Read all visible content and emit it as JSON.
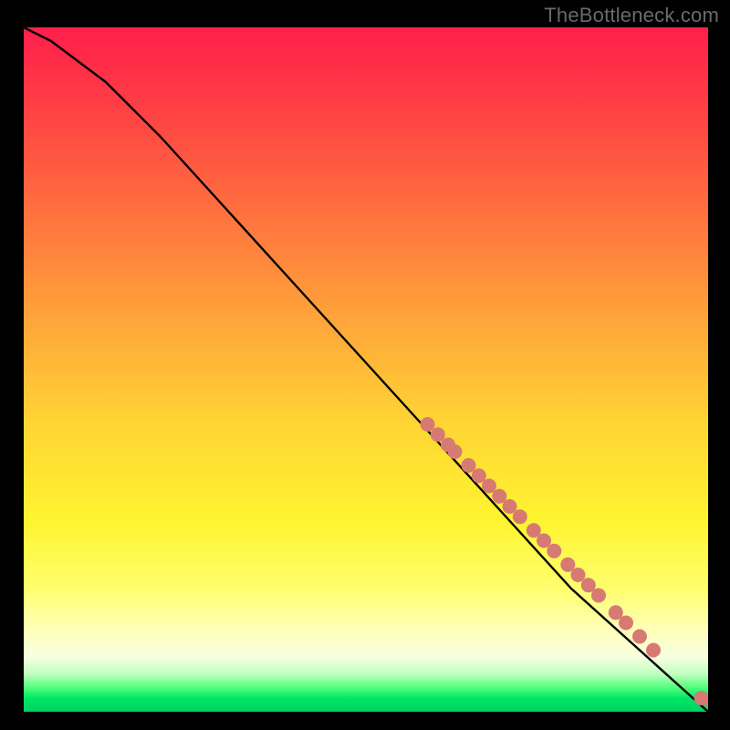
{
  "watermark": "TheBottleneck.com",
  "chart_data": {
    "type": "line",
    "title": "",
    "xlabel": "",
    "ylabel": "",
    "xlim": [
      0,
      100
    ],
    "ylim": [
      0,
      100
    ],
    "curve": {
      "name": "bottleneck-curve",
      "x": [
        0,
        4,
        8,
        12,
        16,
        20,
        30,
        40,
        50,
        60,
        70,
        80,
        90,
        95,
        100
      ],
      "y": [
        100,
        98,
        95,
        92,
        88,
        84,
        73,
        62,
        51,
        40,
        29,
        18,
        9,
        4.5,
        0
      ]
    },
    "markers": {
      "name": "highlighted-points",
      "color": "#d87a74",
      "points": [
        {
          "x": 59.0,
          "y": 42.0
        },
        {
          "x": 60.5,
          "y": 40.5
        },
        {
          "x": 62.0,
          "y": 39.0
        },
        {
          "x": 63.0,
          "y": 38.0
        },
        {
          "x": 65.0,
          "y": 36.0
        },
        {
          "x": 66.5,
          "y": 34.5
        },
        {
          "x": 68.0,
          "y": 33.0
        },
        {
          "x": 69.5,
          "y": 31.5
        },
        {
          "x": 71.0,
          "y": 30.0
        },
        {
          "x": 72.5,
          "y": 28.5
        },
        {
          "x": 74.5,
          "y": 26.5
        },
        {
          "x": 76.0,
          "y": 25.0
        },
        {
          "x": 77.5,
          "y": 23.5
        },
        {
          "x": 79.5,
          "y": 21.5
        },
        {
          "x": 81.0,
          "y": 20.0
        },
        {
          "x": 82.5,
          "y": 18.5
        },
        {
          "x": 84.0,
          "y": 17.0
        },
        {
          "x": 86.5,
          "y": 14.5
        },
        {
          "x": 88.0,
          "y": 13.0
        },
        {
          "x": 90.0,
          "y": 11.0
        },
        {
          "x": 92.0,
          "y": 9.0
        },
        {
          "x": 99.0,
          "y": 2.0
        },
        {
          "x": 100.5,
          "y": 1.5
        }
      ]
    }
  }
}
